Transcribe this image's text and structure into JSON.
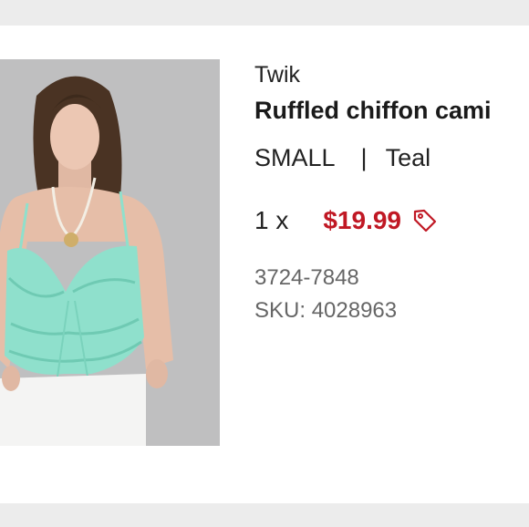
{
  "product": {
    "brand": "Twik",
    "title": "Ruffled chiffon cami",
    "size": "SMALL",
    "separator": "|",
    "color": "Teal",
    "quantity": "1 x",
    "price": "$19.99",
    "code": "3724-7848",
    "sku_label": "SKU:",
    "sku_value": "4028963"
  },
  "icons": {
    "price_tag": "tag-icon"
  },
  "colors": {
    "price": "#c01824",
    "garment": "#8fe0cc"
  }
}
